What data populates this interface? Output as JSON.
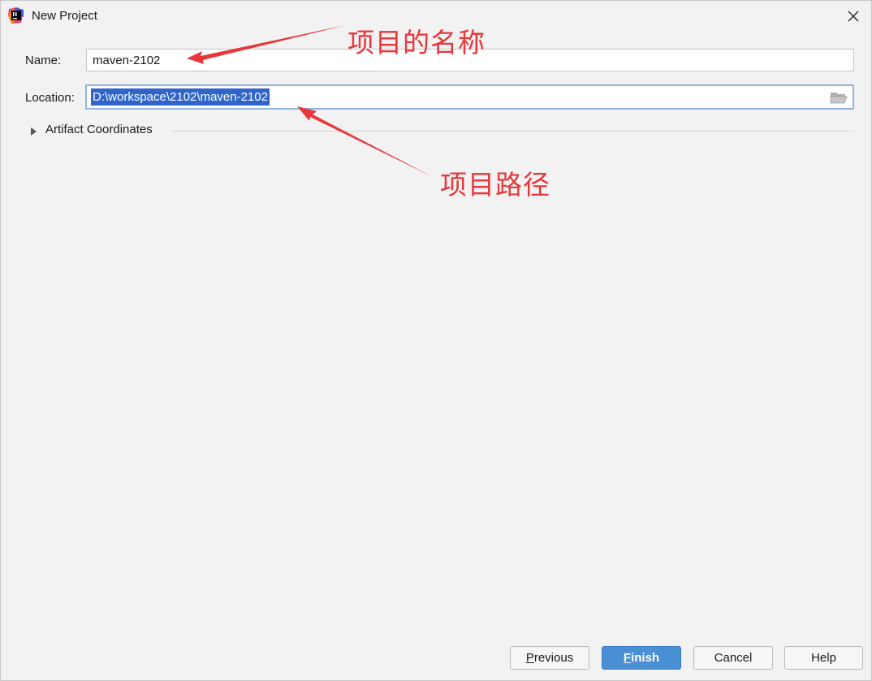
{
  "window": {
    "title": "New Project"
  },
  "form": {
    "name_label": "Name:",
    "name_value": "maven-2102",
    "location_label": "Location:",
    "location_value": "D:\\workspace\\2102\\maven-2102"
  },
  "artifact": {
    "label": "Artifact Coordinates"
  },
  "annotations": {
    "name_note": "项目的名称",
    "path_note": "项目路径"
  },
  "buttons": {
    "previous_mnemonic": "P",
    "previous_rest": "revious",
    "finish_mnemonic": "F",
    "finish_rest": "inish",
    "cancel": "Cancel",
    "help": "Help"
  },
  "colors": {
    "annotation": "#e8363b",
    "primary_button": "#4a8fd4",
    "selection": "#2f65ca",
    "focus_border": "#8fb4e0"
  }
}
